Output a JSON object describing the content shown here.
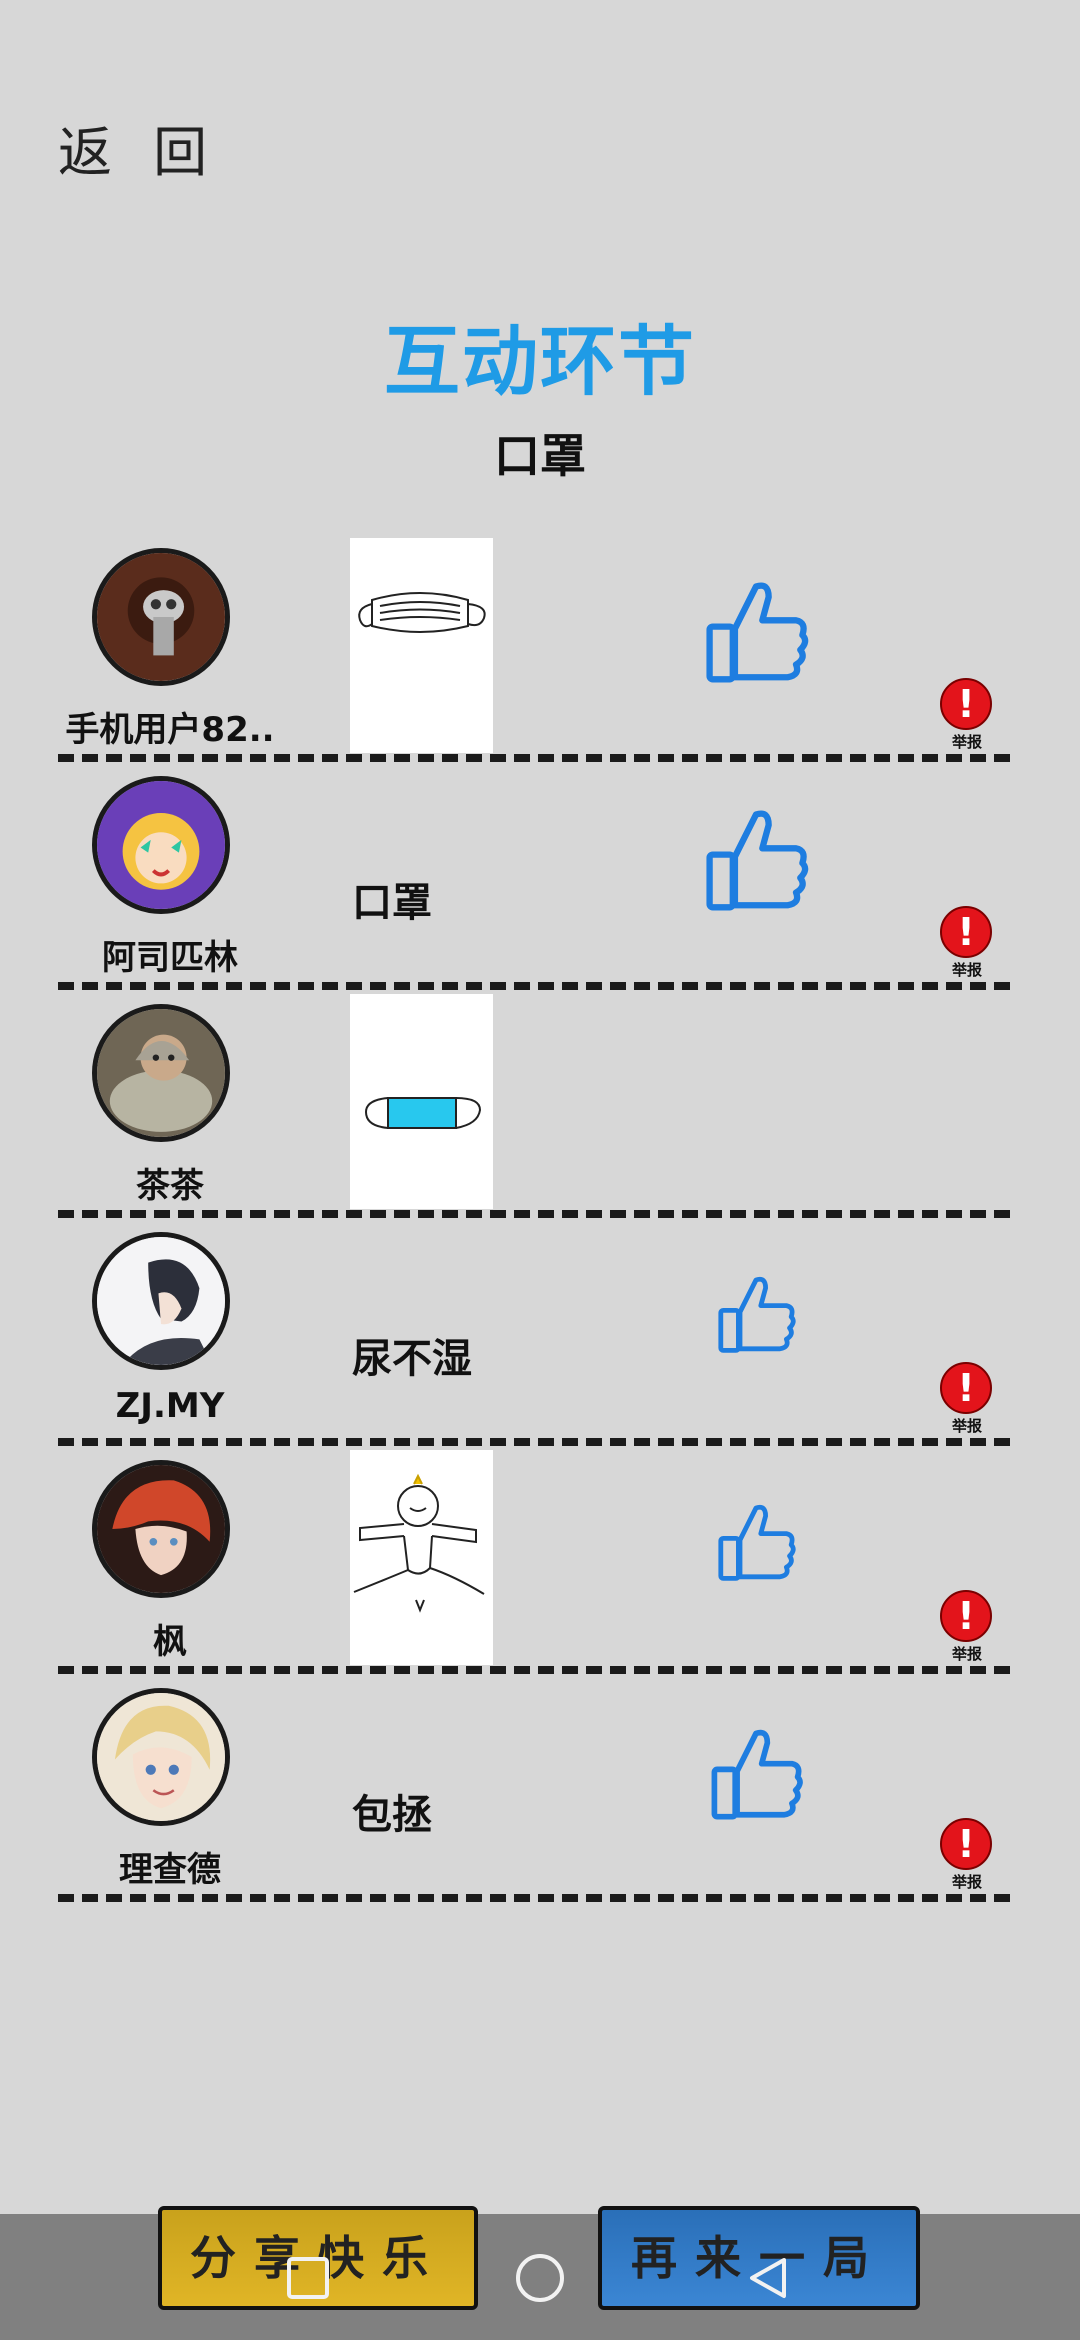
{
  "header": {
    "back_label": "返 回"
  },
  "title": "互动环节",
  "subtitle": "口罩",
  "report_label": "举报",
  "colors": {
    "title": "#1f9be6",
    "like": "#1e7de0",
    "report": "#e3141b",
    "share_button": "#d9ae22",
    "again_button": "#2f7cc8"
  },
  "players": [
    {
      "name": "手机用户82..",
      "answer_type": "drawing",
      "drawing": "mask-outline",
      "answer": "",
      "thumb_size": "large",
      "reportable": true
    },
    {
      "name": "阿司匹林",
      "answer_type": "text",
      "answer": "口罩",
      "thumb_size": "large",
      "reportable": true
    },
    {
      "name": "茶茶",
      "answer_type": "drawing",
      "drawing": "mask-blue",
      "answer": "",
      "thumb_size": "none",
      "reportable": false
    },
    {
      "name": "ZJ.MY",
      "answer_type": "text",
      "answer": "尿不湿",
      "thumb_size": "small",
      "reportable": true
    },
    {
      "name": "枫",
      "answer_type": "drawing",
      "drawing": "stick-figure",
      "answer": "",
      "thumb_size": "small",
      "reportable": true
    },
    {
      "name": "理查德",
      "answer_type": "text",
      "answer": "包拯",
      "thumb_size": "medium",
      "reportable": true
    }
  ],
  "buttons": {
    "share_label": "分享快乐",
    "again_label": "再来一局"
  },
  "system_nav": [
    "square-icon",
    "circle-icon",
    "back-triangle-icon"
  ]
}
